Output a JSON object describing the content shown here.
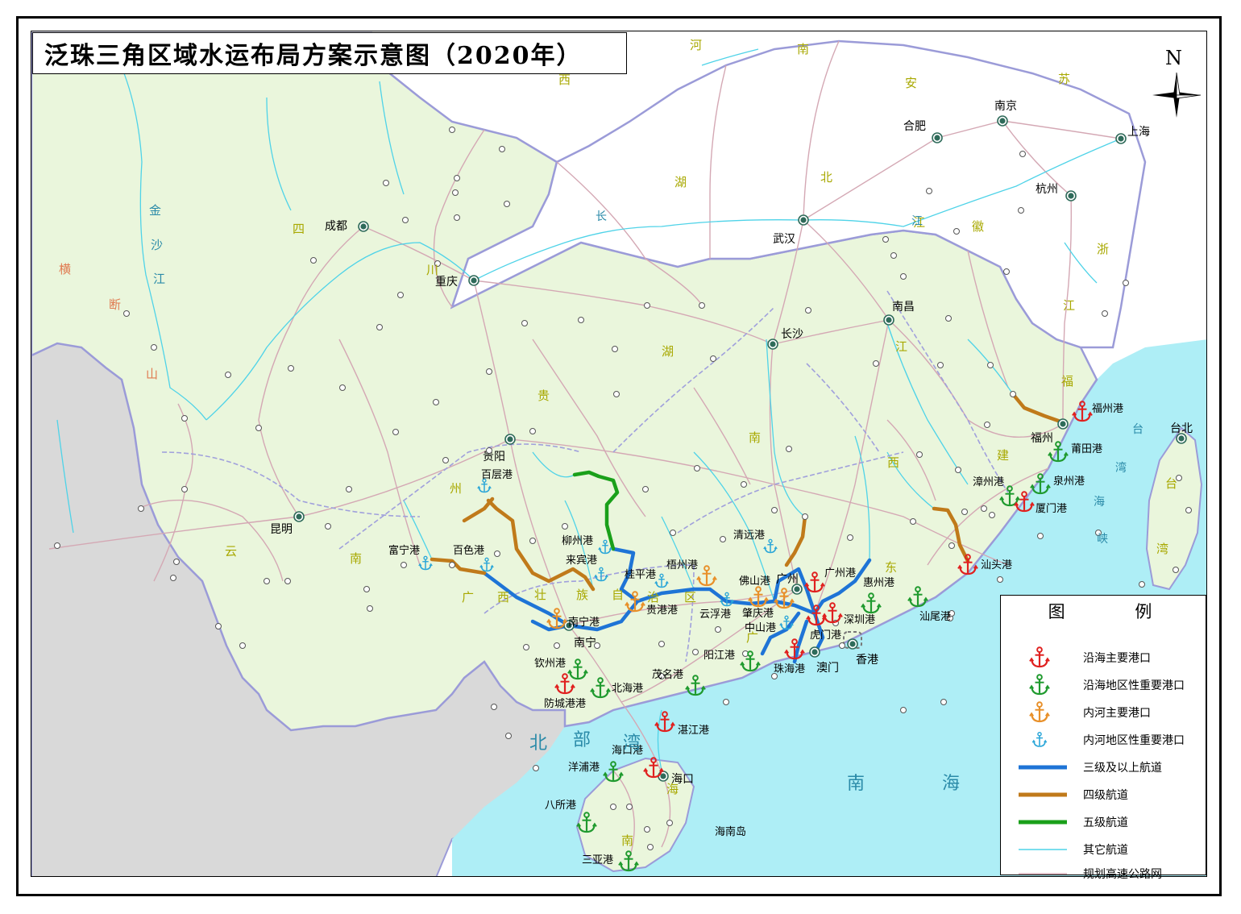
{
  "title": "泛珠三角区域水运布局方案示意图（2020年）",
  "north_label": "N",
  "legend": {
    "title": "图 例",
    "items": [
      {
        "label": "沿海主要港口",
        "symbol": "anchor",
        "color": "#e0201f"
      },
      {
        "label": "沿海地区性重要港口",
        "symbol": "anchor",
        "color": "#1f9a2e"
      },
      {
        "label": "内河主要港口",
        "symbol": "anchor",
        "color": "#e8902a"
      },
      {
        "label": "内河地区性重要港口",
        "symbol": "anchor",
        "color": "#2aa6d8"
      },
      {
        "label": "三级及以上航道",
        "symbol": "line",
        "color": "#1e74d6",
        "width": 5
      },
      {
        "label": "四级航道",
        "symbol": "line",
        "color": "#c07a1a",
        "width": 5
      },
      {
        "label": "五级航道",
        "symbol": "line",
        "color": "#1aa01a",
        "width": 5
      },
      {
        "label": "其它航道",
        "symbol": "line",
        "color": "#4fd3e8",
        "width": 1.5
      },
      {
        "label": "规划高速公路网",
        "symbol": "line",
        "color": "#d4a8b4",
        "width": 1.5
      }
    ]
  },
  "colors": {
    "region_fill": "#eaf6dc",
    "outside_fill": "#ffffff",
    "foreign_fill": "#d9d9d9",
    "sea": "#aeeef6",
    "province_border": "#9b9bd8",
    "river": "#4fd3e8",
    "highway": "#d4a8b4",
    "region_label": "#a8a800",
    "water_label": "#2a8aa8",
    "river_name": "#e07a50"
  },
  "cities": [
    {
      "name": "成都"
    },
    {
      "name": "重庆"
    },
    {
      "name": "武汉"
    },
    {
      "name": "长沙"
    },
    {
      "name": "南昌"
    },
    {
      "name": "合肥"
    },
    {
      "name": "南京"
    },
    {
      "name": "上海"
    },
    {
      "name": "杭州"
    },
    {
      "name": "福州"
    },
    {
      "name": "台北"
    },
    {
      "name": "贵阳"
    },
    {
      "name": "昆明"
    },
    {
      "name": "南宁"
    },
    {
      "name": "广州"
    },
    {
      "name": "澳门"
    },
    {
      "name": "香港"
    },
    {
      "name": "海口"
    }
  ],
  "region_labels": [
    "河",
    "南",
    "安",
    "苏",
    "西",
    "湖",
    "北",
    "江",
    "徽",
    "浙",
    "江",
    "四",
    "川",
    "湖",
    "南",
    "江",
    "西",
    "福",
    "建",
    "贵",
    "州",
    "云",
    "南",
    "广",
    "西",
    "壮",
    "族",
    "自",
    "治",
    "区",
    "广",
    "东",
    "台",
    "湾",
    "海",
    "南"
  ],
  "water_labels": [
    "北",
    "部",
    "湾",
    "南",
    "海",
    "台",
    "湾",
    "海",
    "峡",
    "长",
    "江"
  ],
  "river_names": [
    "金",
    "沙",
    "江",
    "横",
    "断",
    "山"
  ],
  "island_label": "海南岛",
  "ports": [
    {
      "name": "福州港",
      "type": 0
    },
    {
      "name": "莆田港",
      "type": 1
    },
    {
      "name": "泉州港",
      "type": 1
    },
    {
      "name": "漳州港",
      "type": 1
    },
    {
      "name": "厦门港",
      "type": 0
    },
    {
      "name": "汕头港",
      "type": 0
    },
    {
      "name": "汕尾港",
      "type": 1
    },
    {
      "name": "惠州港",
      "type": 1
    },
    {
      "name": "深圳港",
      "type": 0
    },
    {
      "name": "虎门港",
      "type": 0
    },
    {
      "name": "广州港",
      "type": 0
    },
    {
      "name": "珠海港",
      "type": 0
    },
    {
      "name": "中山港",
      "type": 3
    },
    {
      "name": "阳江港",
      "type": 1
    },
    {
      "name": "茂名港",
      "type": 1
    },
    {
      "name": "湛江港",
      "type": 0
    },
    {
      "name": "北海港",
      "type": 1
    },
    {
      "name": "钦州港",
      "type": 1
    },
    {
      "name": "防城港港",
      "type": 0
    },
    {
      "name": "海口港",
      "type": 0
    },
    {
      "name": "洋浦港",
      "type": 1
    },
    {
      "name": "八所港",
      "type": 1
    },
    {
      "name": "三亚港",
      "type": 1
    },
    {
      "name": "清远港",
      "type": 3
    },
    {
      "name": "佛山港",
      "type": 2
    },
    {
      "name": "肇庆港",
      "type": 2
    },
    {
      "name": "云浮港",
      "type": 3
    },
    {
      "name": "梧州港",
      "type": 2
    },
    {
      "name": "贵港港",
      "type": 2
    },
    {
      "name": "桂平港",
      "type": 3
    },
    {
      "name": "来宾港",
      "type": 3
    },
    {
      "name": "柳州港",
      "type": 3
    },
    {
      "name": "南宁港",
      "type": 2
    },
    {
      "name": "百色港",
      "type": 3
    },
    {
      "name": "富宁港",
      "type": 3
    },
    {
      "name": "百层港",
      "type": 3
    }
  ]
}
